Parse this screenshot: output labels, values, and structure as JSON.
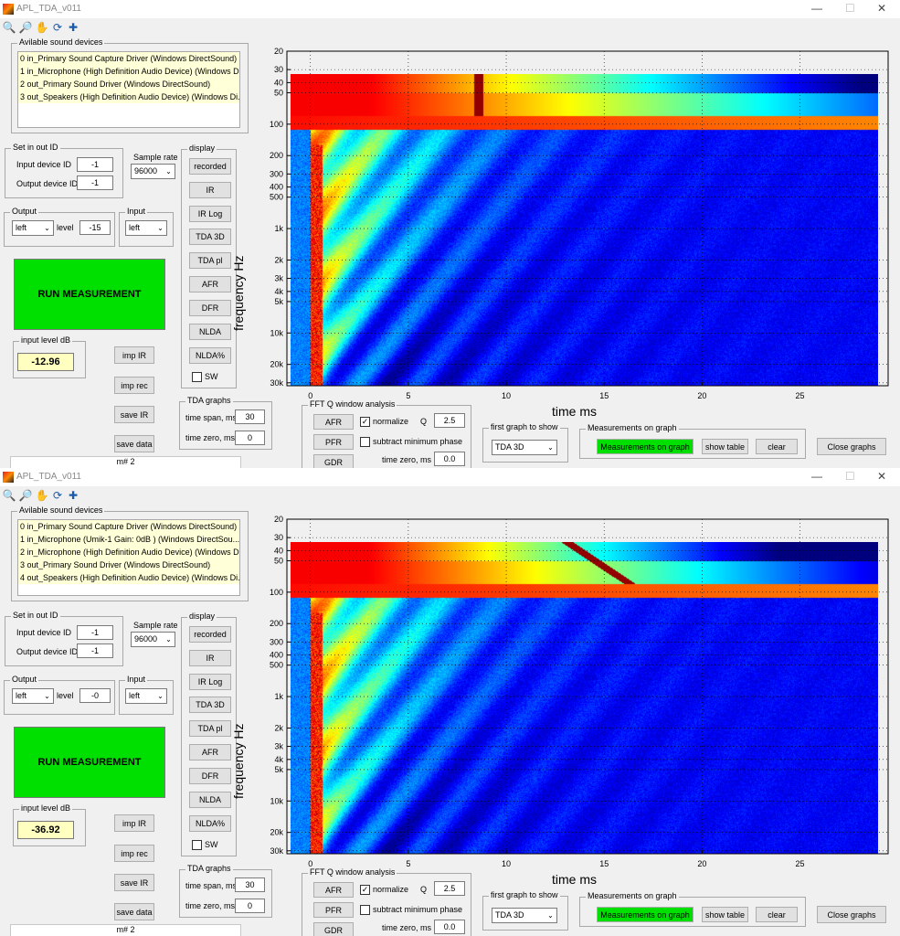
{
  "windows": [
    {
      "title": "APL_TDA_v011",
      "devices_group": "Avilable sound devices",
      "devices": [
        "0 in_Primary Sound Capture Driver (Windows DirectSound)",
        "1 in_Microphone (High Definition Audio Device) (Windows D...",
        "2 out_Primary Sound Driver (Windows DirectSound)",
        "3 out_Speakers (High Definition Audio Device) (Windows Di..."
      ],
      "setio_group": "Set in out ID",
      "input_device_label": "Input device ID",
      "input_device_value": "-1",
      "output_device_label": "Output device ID",
      "output_device_value": "-1",
      "samplerate_label": "Sample rate",
      "samplerate_value": "96000",
      "output_group": "Output",
      "output_value": "left",
      "level_label": "level",
      "level_value": "-15",
      "input_group": "Input",
      "input_value": "left",
      "run_label": "RUN MEASUREMENT",
      "inputlevel_group": "input level dB",
      "inputlevel_value": "-12.96",
      "imp_ir": "imp IR",
      "imp_rec": "imp rec",
      "save_ir": "save IR",
      "save_data": "save data",
      "display_group": "display",
      "display_buttons": [
        "recorded",
        "IR",
        "IR Log",
        "TDA 3D",
        "TDA pl",
        "AFR",
        "DFR",
        "NLDA",
        "NLDA%"
      ],
      "sw_label": "SW",
      "tda_group": "TDA graphs",
      "timespan_label": "time span, ms",
      "timespan_value": "30",
      "timezero_label": "time zero, ms",
      "timezero_value": "0",
      "status": "m# 2",
      "fft_group": "FFT Q window analysis",
      "afr": "AFR",
      "pfr": "PFR",
      "gdr": "GDR",
      "normalize": "normalize",
      "q_label": "Q",
      "q_value": "2.5",
      "subtract_min_phase": "subtract minimum phase",
      "fft_timezero_label": "time zero, ms",
      "fft_timezero_value": "0.0",
      "firstgraph_group": "first graph to show",
      "firstgraph_value": "TDA 3D",
      "meas_group": "Measurements on graph",
      "meas_btn": "Measurements on graph",
      "show_table": "show table",
      "clear": "clear",
      "close_graphs": "Close graphs",
      "chart_ylabel": "frequency  Hz",
      "chart_xlabel": "time   ms"
    },
    {
      "title": "APL_TDA_v011",
      "devices_group": "Avilable sound devices",
      "devices": [
        "0 in_Primary Sound Capture Driver (Windows DirectSound)",
        "1 in_Microphone (Umik-1  Gain:  0dB  ) (Windows DirectSou...",
        "2 in_Microphone (High Definition Audio Device) (Windows D...",
        "3 out_Primary Sound Driver (Windows DirectSound)",
        "4 out_Speakers (High Definition Audio Device) (Windows Di..."
      ],
      "setio_group": "Set in out ID",
      "input_device_label": "Input device ID",
      "input_device_value": "-1",
      "output_device_label": "Output device ID",
      "output_device_value": "-1",
      "samplerate_label": "Sample rate",
      "samplerate_value": "96000",
      "output_group": "Output",
      "output_value": "left",
      "level_label": "level",
      "level_value": "-0",
      "input_group": "Input",
      "input_value": "left",
      "run_label": "RUN MEASUREMENT",
      "inputlevel_group": "input level dB",
      "inputlevel_value": "-36.92",
      "imp_ir": "imp IR",
      "imp_rec": "imp rec",
      "save_ir": "save IR",
      "save_data": "save data",
      "display_group": "display",
      "display_buttons": [
        "recorded",
        "IR",
        "IR Log",
        "TDA 3D",
        "TDA pl",
        "AFR",
        "DFR",
        "NLDA",
        "NLDA%"
      ],
      "sw_label": "SW",
      "tda_group": "TDA graphs",
      "timespan_label": "time span, ms",
      "timespan_value": "30",
      "timezero_label": "time zero, ms",
      "timezero_value": "0",
      "status": "m# 2",
      "fft_group": "FFT Q window analysis",
      "afr": "AFR",
      "pfr": "PFR",
      "gdr": "GDR",
      "normalize": "normalize",
      "q_label": "Q",
      "q_value": "2.5",
      "subtract_min_phase": "subtract minimum phase",
      "fft_timezero_label": "time zero, ms",
      "fft_timezero_value": "0.0",
      "firstgraph_group": "first graph to show",
      "firstgraph_value": "TDA 3D",
      "meas_group": "Measurements on graph",
      "meas_btn": "Measurements on graph",
      "show_table": "show table",
      "clear": "clear",
      "close_graphs": "Close graphs",
      "chart_ylabel": "frequency  Hz",
      "chart_xlabel": "time   ms"
    }
  ],
  "chart_data": {
    "type": "heatmap",
    "x_ticks": [
      0,
      5,
      10,
      15,
      20,
      25
    ],
    "xlim": [
      -1.2,
      29.5
    ],
    "data_xlim": [
      -1.0,
      29.0
    ],
    "y_scale": "log",
    "y_ticks": [
      "20",
      "30",
      "40",
      "50",
      "100",
      "200",
      "300",
      "400",
      "500",
      "1k",
      "2k",
      "3k",
      "4k",
      "5k",
      "10k",
      "20k",
      "30k"
    ],
    "y_tick_values": [
      20,
      30,
      40,
      50,
      100,
      200,
      300,
      400,
      500,
      1000,
      2000,
      3000,
      4000,
      5000,
      10000,
      20000,
      30000
    ],
    "ylim": [
      20,
      32000
    ],
    "data_ylim": [
      33,
      32000
    ],
    "colormap": "jet",
    "grid": true,
    "accent_green": "#00e000"
  }
}
